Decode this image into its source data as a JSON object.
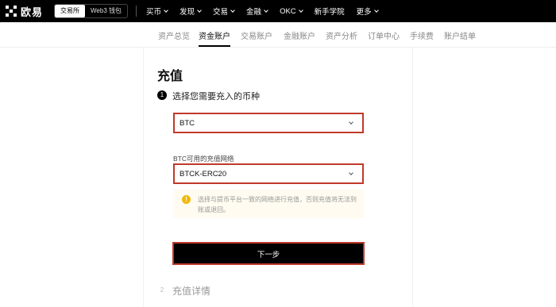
{
  "brand": {
    "name": "欧易"
  },
  "mode_switch": {
    "exchange": "交易所",
    "wallet": "Web3 钱包"
  },
  "nav": {
    "items": [
      {
        "label": "买币",
        "dropdown": true
      },
      {
        "label": "发现",
        "dropdown": true
      },
      {
        "label": "交易",
        "dropdown": true
      },
      {
        "label": "金融",
        "dropdown": true
      },
      {
        "label": "OKC",
        "dropdown": true
      },
      {
        "label": "新手学院",
        "dropdown": false
      },
      {
        "label": "更多",
        "dropdown": true
      }
    ]
  },
  "subnav": {
    "items": [
      "资产总览",
      "资金账户",
      "交易账户",
      "金融账户",
      "资产分析",
      "订单中心",
      "手续费",
      "账户结单"
    ],
    "active": "资金账户"
  },
  "page": {
    "title": "充值"
  },
  "step1": {
    "number": "1",
    "label": "选择您需要充入的币种",
    "coin_select_value": "BTC",
    "network_label": "BTC可用的充值网络",
    "network_select_value": "BTCK-ERC20",
    "notice_icon": "!",
    "notice_text": "选择与提币平台一致的网络进行充值，否则充值将无法到账或退回。"
  },
  "next_button": {
    "label": "下一步"
  },
  "step2": {
    "number": "2",
    "label": "充值详情"
  },
  "colors": {
    "highlight_border": "#c0392b",
    "notice_bg": "#fffbf0",
    "warning_icon": "#f0b90b",
    "navbar_bg": "#000000"
  }
}
